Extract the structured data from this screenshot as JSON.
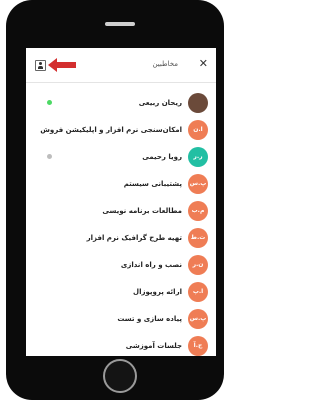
{
  "header": {
    "title": "مخاطبین",
    "close_icon": "close-icon",
    "profile_icon": "user-icon"
  },
  "colors": {
    "online": "#4cd964",
    "offline": "#bdbdbd",
    "arrow": "#d32f2f",
    "avatar_orange": "#ef7d55",
    "avatar_teal": "#22bfa3"
  },
  "contacts": [
    {
      "name": "ریحان ربیعی",
      "initials": "",
      "status": "online"
    },
    {
      "name": "امکان‌سنجی نرم افزار و اپلیکیشن فروش",
      "initials": "ا.ن",
      "status": ""
    },
    {
      "name": "رویا رحیمی",
      "initials": "ر.ر",
      "status": "offline"
    },
    {
      "name": "پشتیبانی سیستم",
      "initials": "پ.س",
      "status": ""
    },
    {
      "name": "مطالعات برنامه نویسی",
      "initials": "م.ب",
      "status": ""
    },
    {
      "name": "تهیه طرح گرافیک نرم افزار",
      "initials": "ت.ط",
      "status": ""
    },
    {
      "name": "نصب و راه اندازی",
      "initials": "ن.ر",
      "status": ""
    },
    {
      "name": "ارائه پروپوزال",
      "initials": "ا.پ",
      "status": ""
    },
    {
      "name": "پیاده سازی و تست",
      "initials": "پ.س",
      "status": ""
    },
    {
      "name": "جلسات آموزشی",
      "initials": "ج.آ",
      "status": ""
    }
  ]
}
